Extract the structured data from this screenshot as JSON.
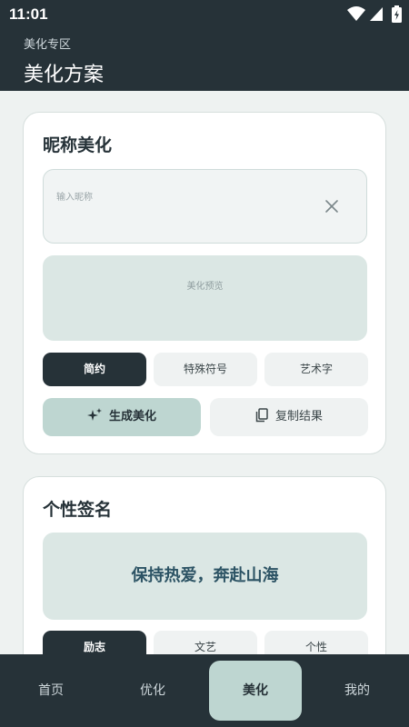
{
  "status_bar": {
    "time": "11:01",
    "icons": [
      "wifi-icon",
      "signal-icon",
      "battery-icon"
    ]
  },
  "header": {
    "subtitle": "美化专区",
    "title": "美化方案"
  },
  "nickname_card": {
    "title": "昵称美化",
    "input_value": "",
    "input_placeholder": "输入昵称",
    "preview_text": "美化预览",
    "styles": [
      {
        "label": "简约",
        "active": true
      },
      {
        "label": "特殊符号",
        "active": false
      },
      {
        "label": "艺术字",
        "active": false
      }
    ],
    "generate_label": "生成美化",
    "copy_label": "复制结果"
  },
  "signature_card": {
    "title": "个性签名",
    "signature_text": "保持热爱，奔赴山海",
    "styles": [
      {
        "label": "励志",
        "active": true
      },
      {
        "label": "文艺",
        "active": false
      },
      {
        "label": "个性",
        "active": false
      }
    ]
  },
  "bottom_nav": {
    "items": [
      {
        "label": "首页",
        "active": false
      },
      {
        "label": "优化",
        "active": false
      },
      {
        "label": "美化",
        "active": true
      },
      {
        "label": "我的",
        "active": false
      }
    ]
  },
  "colors": {
    "header_bg": "#263238",
    "accent": "#bed6d1",
    "page_bg": "#eef2f1",
    "signature_text": "#2c5364"
  }
}
